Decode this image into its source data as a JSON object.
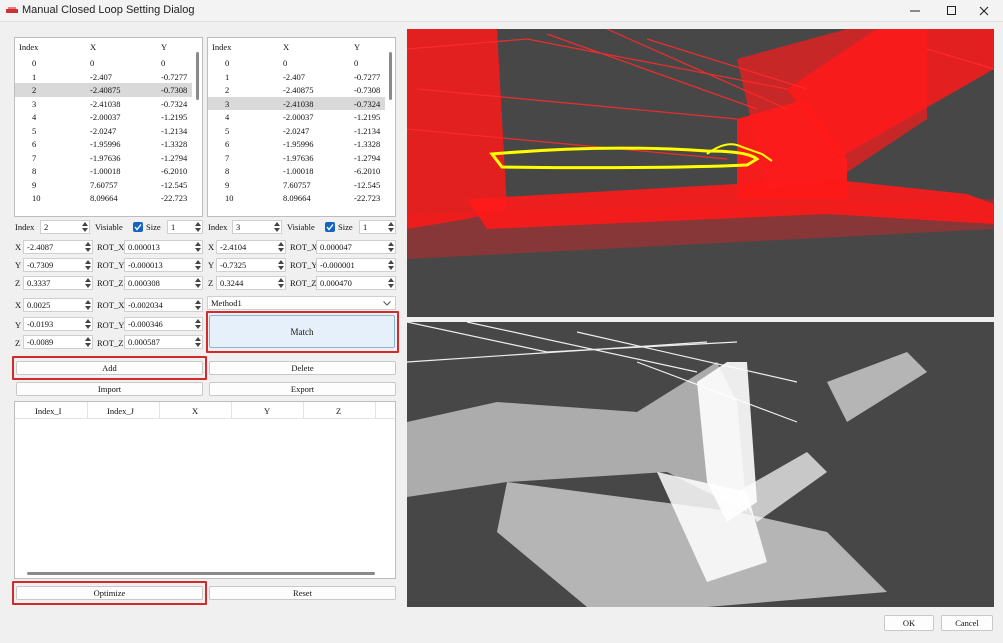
{
  "window": {
    "title": "Manual Closed Loop Setting Dialog"
  },
  "table_left": {
    "headers": [
      "Index",
      "X",
      "Y"
    ],
    "selected": 2,
    "rows": [
      [
        "0",
        "0",
        "0"
      ],
      [
        "1",
        "-2.407",
        "-0.7277"
      ],
      [
        "2",
        "-2.40875",
        "-0.7308"
      ],
      [
        "3",
        "-2.41038",
        "-0.7324"
      ],
      [
        "4",
        "-2.00037",
        "-1.2195"
      ],
      [
        "5",
        "-2.0247",
        "-1.2134"
      ],
      [
        "6",
        "-1.95996",
        "-1.3328"
      ],
      [
        "7",
        "-1.97636",
        "-1.2794"
      ],
      [
        "8",
        "-1.00018",
        "-6.2010"
      ],
      [
        "9",
        "7.60757",
        "-12.545"
      ],
      [
        "10",
        "8.09664",
        "-22.723"
      ]
    ]
  },
  "table_right": {
    "headers": [
      "Index",
      "X",
      "Y"
    ],
    "selected": 3,
    "rows": [
      [
        "0",
        "0",
        "0"
      ],
      [
        "1",
        "-2.407",
        "-0.7277"
      ],
      [
        "2",
        "-2.40875",
        "-0.7308"
      ],
      [
        "3",
        "-2.41038",
        "-0.7324"
      ],
      [
        "4",
        "-2.00037",
        "-1.2195"
      ],
      [
        "5",
        "-2.0247",
        "-1.2134"
      ],
      [
        "6",
        "-1.95996",
        "-1.3328"
      ],
      [
        "7",
        "-1.97636",
        "-1.2794"
      ],
      [
        "8",
        "-1.00018",
        "-6.2010"
      ],
      [
        "9",
        "7.60757",
        "-12.545"
      ],
      [
        "10",
        "8.09664",
        "-22.723"
      ]
    ]
  },
  "left_controls": {
    "index_label": "Index",
    "index_value": "2",
    "visiable_label": "Visiable",
    "size_label": "Size",
    "size_value": "1",
    "x_label": "X",
    "x_value": "-2.4087",
    "rotx_label": "ROT_X",
    "rotx_value": "0.000013",
    "y_label": "Y",
    "y_value": "-0.7309",
    "roty_label": "ROT_Y",
    "roty_value": "-0.000013",
    "z_label": "Z",
    "z_value": "0.3337",
    "rotz_label": "ROT_Z",
    "rotz_value": "0.000308"
  },
  "right_controls": {
    "index_label": "Index",
    "index_value": "3",
    "visiable_label": "Visiable",
    "size_label": "Size",
    "size_value": "1",
    "x_label": "X",
    "x_value": "-2.4104",
    "rotx_label": "ROT_X",
    "rotx_value": "0.000047",
    "y_label": "Y",
    "y_value": "-0.7325",
    "roty_label": "ROT_Y",
    "roty_value": "-0.000001",
    "z_label": "Z",
    "z_value": "0.3244",
    "rotz_label": "ROT_Z",
    "rotz_value": "0.000470"
  },
  "offset_controls": {
    "x_label": "X",
    "x_value": "0.0025",
    "rotx_label": "ROT_X",
    "rotx_value": "-0.002034",
    "y_label": "Y",
    "y_value": "-0.0193",
    "roty_label": "ROT_Y",
    "roty_value": "-0.000346",
    "z_label": "Z",
    "z_value": "-0.0089",
    "rotz_label": "ROT_Z",
    "rotz_value": "0.000587"
  },
  "method": {
    "selected": "Method1"
  },
  "buttons": {
    "match": "Match",
    "add": "Add",
    "delete": "Delete",
    "import": "Import",
    "export": "Export",
    "optimize": "Optimize",
    "reset": "Reset",
    "ok": "OK",
    "cancel": "Cancel"
  },
  "loop_table": {
    "headers": [
      "Index_I",
      "Index_J",
      "X",
      "Y",
      "Z"
    ]
  },
  "colors": {
    "highlight_box": "#d42a2a",
    "checkbox": "#1565c0",
    "view_bg": "#474747",
    "source_cloud": "#ff0000",
    "trajectory": "#ffff00",
    "target_cloud": "#ffffff"
  },
  "icons": {
    "app": "app-icon",
    "minimize": "minimize-icon",
    "maximize": "maximize-icon",
    "close": "close-icon",
    "dropdown": "chevron-down-icon",
    "check": "check-icon"
  }
}
